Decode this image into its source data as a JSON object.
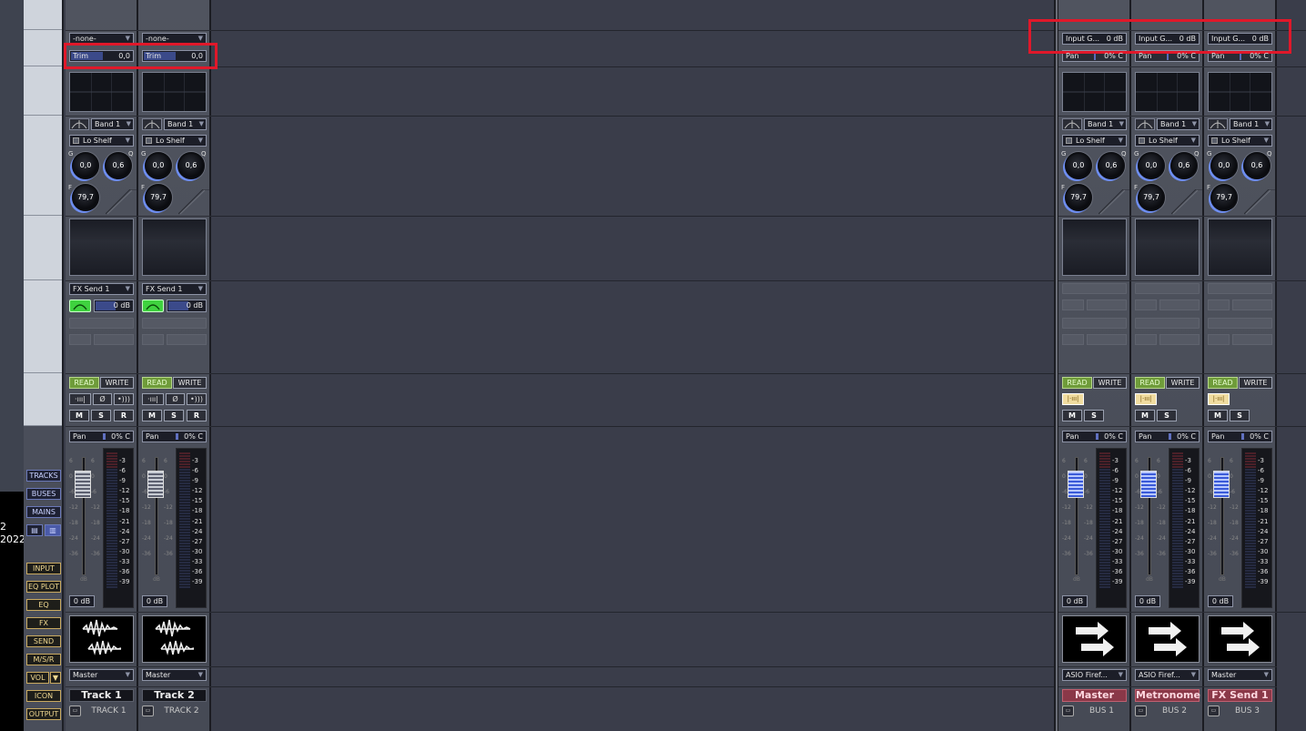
{
  "left_panel": {
    "date_line1": "2",
    "date_line2": "2022",
    "view_buttons": [
      "TRACKS",
      "BUSES",
      "MAINS"
    ],
    "section_buttons": [
      "INPUT",
      "EQ PLOT",
      "EQ",
      "FX",
      "SEND",
      "M/S/R",
      "VOL",
      "ICON",
      "OUTPUT"
    ],
    "vol_arrow": "▼"
  },
  "tracks": [
    {
      "input": "-none-",
      "trim_label": "Trim",
      "trim_value": "0,0",
      "band": "Band 1",
      "shelf": "Lo Shelf",
      "gain": "0,0",
      "q": "0,6",
      "freq": "79,7",
      "send_select": "FX Send 1",
      "send_value": "0 dB",
      "read": "READ",
      "write": "WRITE",
      "phase_icon": "Ø",
      "m": "M",
      "s": "S",
      "r": "R",
      "pan_label": "Pan",
      "pan_value": "0% C",
      "volume": "0 dB",
      "output": "Master",
      "name": "Track 1",
      "type": "TRACK 1"
    },
    {
      "input": "-none-",
      "trim_label": "Trim",
      "trim_value": "0,0",
      "band": "Band 1",
      "shelf": "Lo Shelf",
      "gain": "0,0",
      "q": "0,6",
      "freq": "79,7",
      "send_select": "FX Send 1",
      "send_value": "0 dB",
      "read": "READ",
      "write": "WRITE",
      "phase_icon": "Ø",
      "m": "M",
      "s": "S",
      "r": "R",
      "pan_label": "Pan",
      "pan_value": "0% C",
      "volume": "0 dB",
      "output": "Master",
      "name": "Track 2",
      "type": "TRACK 2"
    }
  ],
  "buses": [
    {
      "input_gain_label": "Input G...",
      "input_gain_value": "0 dB",
      "pan_label": "Pan",
      "pan_value": "0% C",
      "band": "Band 1",
      "shelf": "Lo Shelf",
      "gain": "0,0",
      "q": "0,6",
      "freq": "79,7",
      "read": "READ",
      "write": "WRITE",
      "m": "M",
      "s": "S",
      "pan2_label": "Pan",
      "pan2_value": "0% C",
      "volume": "0 dB",
      "output": "ASIO Firef...",
      "name": "Master",
      "type": "BUS 1"
    },
    {
      "input_gain_label": "Input G...",
      "input_gain_value": "0 dB",
      "pan_label": "Pan",
      "pan_value": "0% C",
      "band": "Band 1",
      "shelf": "Lo Shelf",
      "gain": "0,0",
      "q": "0,6",
      "freq": "79,7",
      "read": "READ",
      "write": "WRITE",
      "m": "M",
      "s": "S",
      "pan2_label": "Pan",
      "pan2_value": "0% C",
      "volume": "0 dB",
      "output": "ASIO Firef...",
      "name": "Metronome",
      "type": "BUS 2"
    },
    {
      "input_gain_label": "Input G...",
      "input_gain_value": "0 dB",
      "pan_label": "Pan",
      "pan_value": "0% C",
      "band": "Band 1",
      "shelf": "Lo Shelf",
      "gain": "0,0",
      "q": "0,6",
      "freq": "79,7",
      "read": "READ",
      "write": "WRITE",
      "m": "M",
      "s": "S",
      "pan2_label": "Pan",
      "pan2_value": "0% C",
      "volume": "0 dB",
      "output": "Master",
      "name": "FX Send 1",
      "type": "BUS 3"
    }
  ],
  "knob_labels": {
    "g": "G",
    "q": "Q",
    "f": "F"
  },
  "fader_scale": [
    "6",
    "0",
    "-6",
    "-12",
    "-18",
    "-24",
    "-36"
  ],
  "fader_unit": "dB",
  "meter_ticks": [
    "-3",
    "-6",
    "-9",
    "-12",
    "-15",
    "-18",
    "-21",
    "-24",
    "-27",
    "-30",
    "-33",
    "-36",
    "-39"
  ],
  "colors": {
    "highlight": "#e0182a",
    "read_green": "#6f9c3a",
    "bus_name": "#8a3848",
    "send_green": "#3fd23f"
  }
}
